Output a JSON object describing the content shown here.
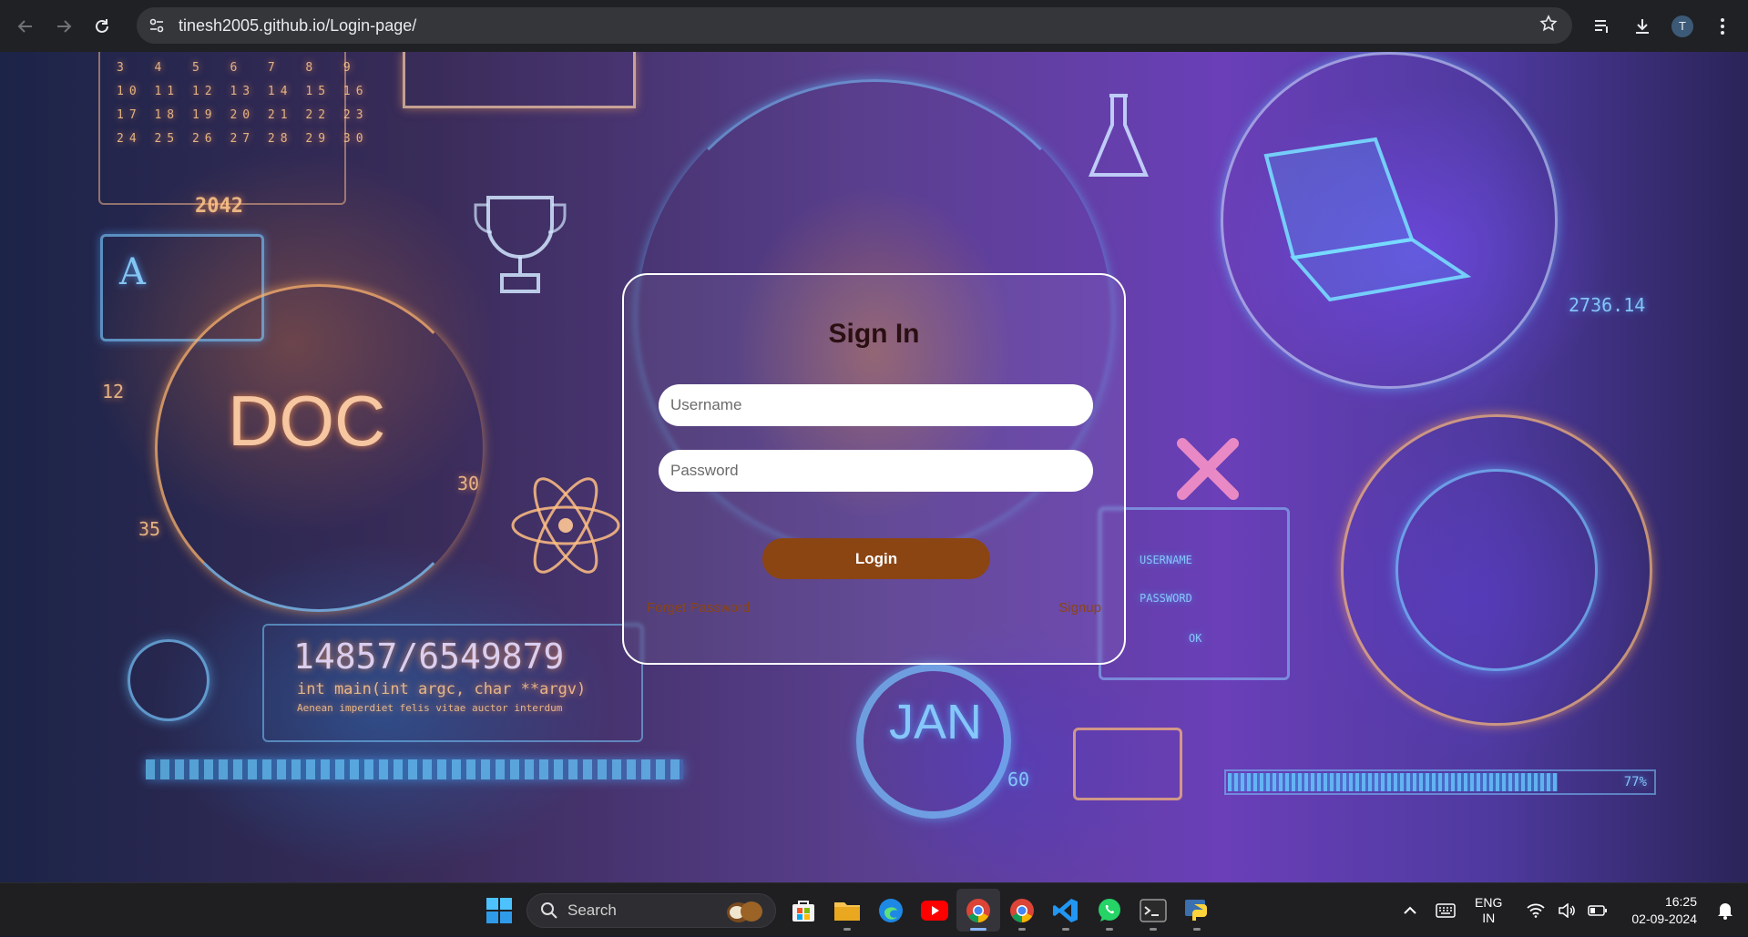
{
  "browser": {
    "url_host": "tinesh2005.github.io",
    "url_path": "/Login-page/",
    "avatar_letter": "T"
  },
  "background": {
    "calendar_rows": [
      "3  4  5  6  7  8  9",
      "10 11 12 13 14 15 16",
      "17 18 19 20 21 22 23",
      "24 25 26 27 28 29 30"
    ],
    "year": "2042",
    "doc_label": "DOC",
    "doc_num_12": "12",
    "doc_num_30": "30",
    "doc_num_35": "35",
    "code_number": "14857/6549879",
    "code_line": "int main(int argc, char **argv)",
    "code_sub": "Aenean imperdiet felis vitae auctor interdum",
    "jan_label": "JAN",
    "jan_num": "60",
    "right_value": "2736.14",
    "progress_label": "77%",
    "progress_fraction": 0.77,
    "panel_username": "USERNAME",
    "panel_password": "PASSWORD",
    "panel_ok": "OK"
  },
  "login": {
    "title": "Sign In",
    "username_placeholder": "Username",
    "password_placeholder": "Password",
    "login_label": "Login",
    "forgot_label": "Forget Password",
    "signup_label": "Signup"
  },
  "taskbar": {
    "search_label": "Search",
    "lang_top": "ENG",
    "lang_bottom": "IN",
    "time": "16:25",
    "date": "02-09-2024"
  },
  "colors": {
    "login_button": "#8b4513",
    "link": "#8b4513",
    "title": "#2a0f12"
  }
}
